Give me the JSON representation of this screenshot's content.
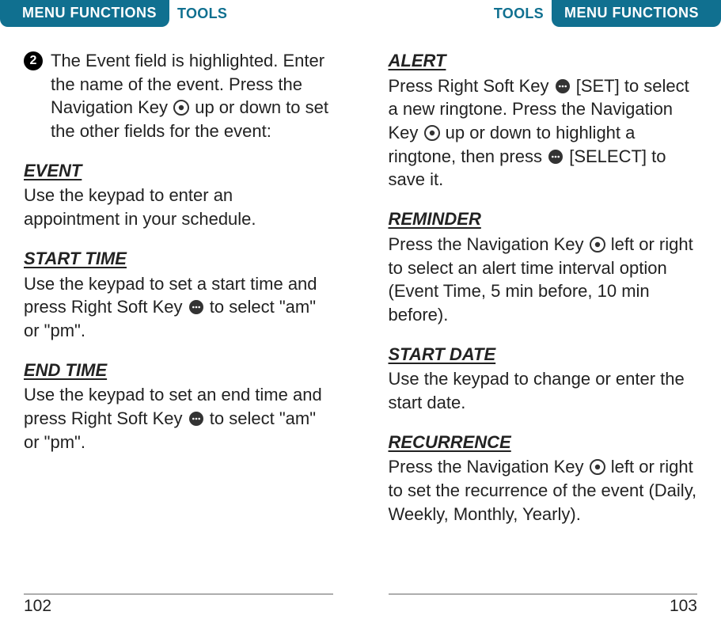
{
  "header": {
    "menu_functions": "MENU FUNCTIONS",
    "tools": "TOOLS"
  },
  "left_page": {
    "number": "102",
    "step2": {
      "num": "2",
      "text_a": "The Event field is highlighted. Enter the name of the event. Press the Navigation Key ",
      "text_b": " up or down to set the other fields for the event:"
    },
    "event": {
      "head": "EVENT",
      "body": "Use the keypad to enter an appointment in your schedule."
    },
    "start_time": {
      "head": "START TIME",
      "body_a": "Use the keypad to set a start time and press Right Soft Key ",
      "body_b": " to select \"am\" or \"pm\"."
    },
    "end_time": {
      "head": "END TIME",
      "body_a": "Use the keypad to set an end time and press Right Soft Key ",
      "body_b": " to select \"am\" or \"pm\"."
    }
  },
  "right_page": {
    "number": "103",
    "alert": {
      "head": "ALERT",
      "body_a": "Press Right Soft Key ",
      "body_b": " [SET] to select a new ringtone. Press the Navigation Key ",
      "body_c": " up or down to highlight a ringtone, then press ",
      "body_d": " [SELECT] to save it."
    },
    "reminder": {
      "head": "REMINDER",
      "body_a": "Press the Navigation Key ",
      "body_b": " left or right to select an alert time interval option (Event Time, 5 min before, 10 min before)."
    },
    "start_date": {
      "head": "START DATE",
      "body": "Use the keypad to change or enter the start date."
    },
    "recurrence": {
      "head": "RECURRENCE",
      "body_a": "Press the Navigation Key ",
      "body_b": " left or right to set the recurrence of the event (Daily, Weekly, Monthly, Yearly)."
    }
  }
}
